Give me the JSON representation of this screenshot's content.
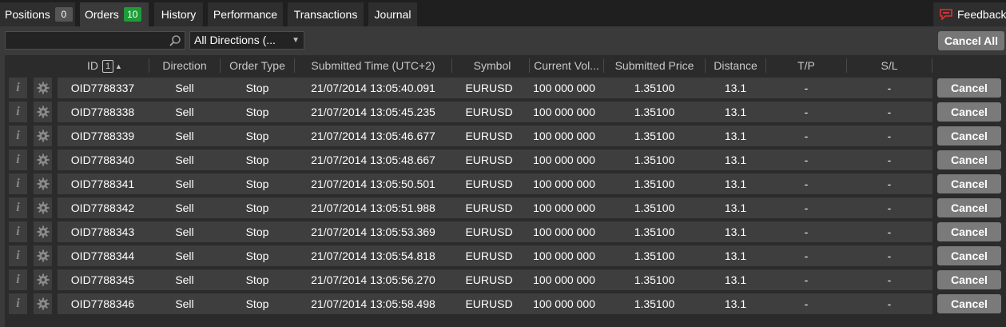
{
  "tabs": [
    {
      "label": "Positions",
      "count": "0"
    },
    {
      "label": "Orders",
      "count": "10"
    },
    {
      "label": "History"
    },
    {
      "label": "Performance"
    },
    {
      "label": "Transactions"
    },
    {
      "label": "Journal"
    }
  ],
  "feedback_label": "Feedback",
  "filter": {
    "search_value": "",
    "direction_selected": "All Directions (..."
  },
  "cancel_all_label": "Cancel All",
  "columns": {
    "id": "ID",
    "id_sort_index": "1",
    "direction": "Direction",
    "order_type": "Order Type",
    "submitted_time": "Submitted Time (UTC+2)",
    "symbol": "Symbol",
    "current_volume": "Current Vol...",
    "submitted_price": "Submitted Price",
    "distance": "Distance",
    "tp": "T/P",
    "sl": "S/L"
  },
  "row_cancel_label": "Cancel",
  "info_icon_glyph": "i",
  "orders": [
    {
      "id": "OID7788337",
      "direction": "Sell",
      "type": "Stop",
      "time": "21/07/2014 13:05:40.091",
      "symbol": "EURUSD",
      "volume": "100 000 000",
      "price": "1.35100",
      "distance": "13.1",
      "tp": "-",
      "sl": "-"
    },
    {
      "id": "OID7788338",
      "direction": "Sell",
      "type": "Stop",
      "time": "21/07/2014 13:05:45.235",
      "symbol": "EURUSD",
      "volume": "100 000 000",
      "price": "1.35100",
      "distance": "13.1",
      "tp": "-",
      "sl": "-"
    },
    {
      "id": "OID7788339",
      "direction": "Sell",
      "type": "Stop",
      "time": "21/07/2014 13:05:46.677",
      "symbol": "EURUSD",
      "volume": "100 000 000",
      "price": "1.35100",
      "distance": "13.1",
      "tp": "-",
      "sl": "-"
    },
    {
      "id": "OID7788340",
      "direction": "Sell",
      "type": "Stop",
      "time": "21/07/2014 13:05:48.667",
      "symbol": "EURUSD",
      "volume": "100 000 000",
      "price": "1.35100",
      "distance": "13.1",
      "tp": "-",
      "sl": "-"
    },
    {
      "id": "OID7788341",
      "direction": "Sell",
      "type": "Stop",
      "time": "21/07/2014 13:05:50.501",
      "symbol": "EURUSD",
      "volume": "100 000 000",
      "price": "1.35100",
      "distance": "13.1",
      "tp": "-",
      "sl": "-"
    },
    {
      "id": "OID7788342",
      "direction": "Sell",
      "type": "Stop",
      "time": "21/07/2014 13:05:51.988",
      "symbol": "EURUSD",
      "volume": "100 000 000",
      "price": "1.35100",
      "distance": "13.1",
      "tp": "-",
      "sl": "-"
    },
    {
      "id": "OID7788343",
      "direction": "Sell",
      "type": "Stop",
      "time": "21/07/2014 13:05:53.369",
      "symbol": "EURUSD",
      "volume": "100 000 000",
      "price": "1.35100",
      "distance": "13.1",
      "tp": "-",
      "sl": "-"
    },
    {
      "id": "OID7788344",
      "direction": "Sell",
      "type": "Stop",
      "time": "21/07/2014 13:05:54.818",
      "symbol": "EURUSD",
      "volume": "100 000 000",
      "price": "1.35100",
      "distance": "13.1",
      "tp": "-",
      "sl": "-"
    },
    {
      "id": "OID7788345",
      "direction": "Sell",
      "type": "Stop",
      "time": "21/07/2014 13:05:56.270",
      "symbol": "EURUSD",
      "volume": "100 000 000",
      "price": "1.35100",
      "distance": "13.1",
      "tp": "-",
      "sl": "-"
    },
    {
      "id": "OID7788346",
      "direction": "Sell",
      "type": "Stop",
      "time": "21/07/2014 13:05:58.498",
      "symbol": "EURUSD",
      "volume": "100 000 000",
      "price": "1.35100",
      "distance": "13.1",
      "tp": "-",
      "sl": "-"
    }
  ],
  "colors": {
    "active_count_badge": "#1e9c38",
    "cancel_button": "#7a7a7a",
    "feedback_icon": "#e03030"
  }
}
